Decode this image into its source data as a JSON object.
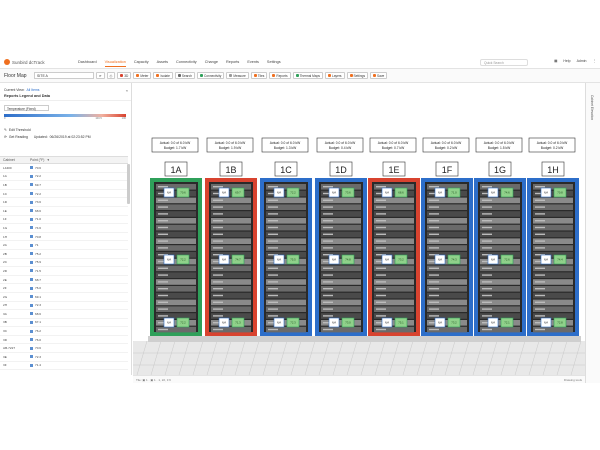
{
  "app": {
    "logo": "Sunbird dcTrack"
  },
  "nav": {
    "items": [
      "Dashboard",
      "Visualization",
      "Capacity",
      "Assets",
      "Connectivity",
      "Change",
      "Reports",
      "Events",
      "Settings"
    ],
    "search_placeholder": "Quick Search",
    "help": "Help",
    "user": "Admin"
  },
  "toolbar": {
    "title": "Floor Map",
    "location": "SITE A",
    "buttons": [
      "3D",
      "Meter",
      "Isolate",
      "Search",
      "Connectivity",
      "Measure",
      "Tiles",
      "Reports",
      "Thermal Maps",
      "Layers",
      "Settings",
      "Save"
    ]
  },
  "sidebar": {
    "current_view_label": "Current View:",
    "current_view_value": "All Items",
    "legend_title": "Reports Legend and Data",
    "temp_select": "Temperature (Fixed)",
    "scale_labels": [
      "0",
      "",
      "",
      "",
      "",
      "",
      "",
      "",
      "",
      "",
      "",
      "",
      "",
      "",
      "",
      "",
      "",
      "",
      "",
      "",
      "100.5",
      "100"
    ],
    "edit_threshold": "Edit Threshold",
    "get_reading": "Get Reading",
    "updated_label": "Updated:",
    "updated_value": "06/26/2019 at 02:23:52 PM",
    "table_head": {
      "name": "Cabinet",
      "value": "Point (°F)"
    },
    "rows": [
      {
        "name": "L4400",
        "value": "70.6"
      },
      {
        "name": "1A",
        "value": "72.2"
      },
      {
        "name": "1B",
        "value": "69.7"
      },
      {
        "name": "1C",
        "value": "72.2"
      },
      {
        "name": "1D",
        "value": "73.6"
      },
      {
        "name": "1E",
        "value": "68.6"
      },
      {
        "name": "1F",
        "value": "71.0"
      },
      {
        "name": "1G",
        "value": "74.6"
      },
      {
        "name": "1H",
        "value": "70.8"
      },
      {
        "name": "2A",
        "value": "71"
      },
      {
        "name": "2B",
        "value": "75.2"
      },
      {
        "name": "2C",
        "value": "75.9"
      },
      {
        "name": "2D",
        "value": "71.5"
      },
      {
        "name": "2E",
        "value": "68.7"
      },
      {
        "name": "2F",
        "value": "76.0"
      },
      {
        "name": "2G",
        "value": "69.1"
      },
      {
        "name": "2H",
        "value": "72.3"
      },
      {
        "name": "3A",
        "value": "68.6"
      },
      {
        "name": "3B",
        "value": "67.1"
      },
      {
        "name": "3C",
        "value": "76.2"
      },
      {
        "name": "3D",
        "value": "76.0"
      },
      {
        "name": "AB-7227",
        "value": "70.6"
      },
      {
        "name": "3E",
        "value": "72.3"
      },
      {
        "name": "3F",
        "value": "71.4"
      }
    ]
  },
  "racks": [
    {
      "label": "1A",
      "actual": "Actual: 0.0 of 6.0 kW",
      "budget": "Budget: 1.7 kW",
      "frame": "#2fa05a",
      "temps": [
        "70.6",
        "72.2",
        "72.2"
      ],
      "tag": "N/A"
    },
    {
      "label": "1B",
      "actual": "Actual: 0.0 of 6.0 kW",
      "budget": "Budget: 1.9 kW",
      "frame": "#d8432f",
      "temps": [
        "69.7",
        "74.7",
        "71.3"
      ],
      "tag": "N/A"
    },
    {
      "label": "1C",
      "actual": "Actual: 0.0 of 6.0 kW",
      "budget": "Budget: 1.3 kW",
      "frame": "#2d6ec9",
      "temps": [
        "72.2",
        "75.5",
        "72.3"
      ],
      "tag": "N/A"
    },
    {
      "label": "1D",
      "actual": "Actual: 0.0 of 6.0 kW",
      "budget": "Budget: 0.4 kW",
      "frame": "#2d6ec9",
      "temps": [
        "73.6",
        "74.8",
        "73.0"
      ],
      "tag": "N/A"
    },
    {
      "label": "1E",
      "actual": "Actual: 0.0 of 6.0 kW",
      "budget": "Budget: 0.7 kW",
      "frame": "#d8432f",
      "temps": [
        "68.6",
        "73.2",
        "75.1"
      ],
      "tag": "N/A"
    },
    {
      "label": "1F",
      "actual": "Actual: 0.0 of 6.0 kW",
      "budget": "Budget: 0.2 kW",
      "frame": "#2d6ec9",
      "temps": [
        "71.0",
        "74.3",
        "73.2"
      ],
      "tag": "N/A"
    },
    {
      "label": "1G",
      "actual": "Actual: 0.0 of 6.0 kW",
      "budget": "Budget: 1.5 kW",
      "frame": "#2d6ec9",
      "temps": [
        "74.6",
        "72.6",
        "72.1"
      ],
      "tag": "N/A"
    },
    {
      "label": "1H",
      "actual": "Actual: 0.0 of 6.0 kW",
      "budget": "Budget: 0.2 kW",
      "frame": "#2d6ec9",
      "temps": [
        "70.8",
        "74.4",
        "72.8"
      ],
      "tag": "N/A"
    }
  ],
  "statusbar": {
    "left": "Tile: ▣ 1 · ▣ 1 · 1, 22, 3 ft",
    "right": "Drawing tools"
  },
  "rail": {
    "label": "Cabinet Elevation"
  }
}
